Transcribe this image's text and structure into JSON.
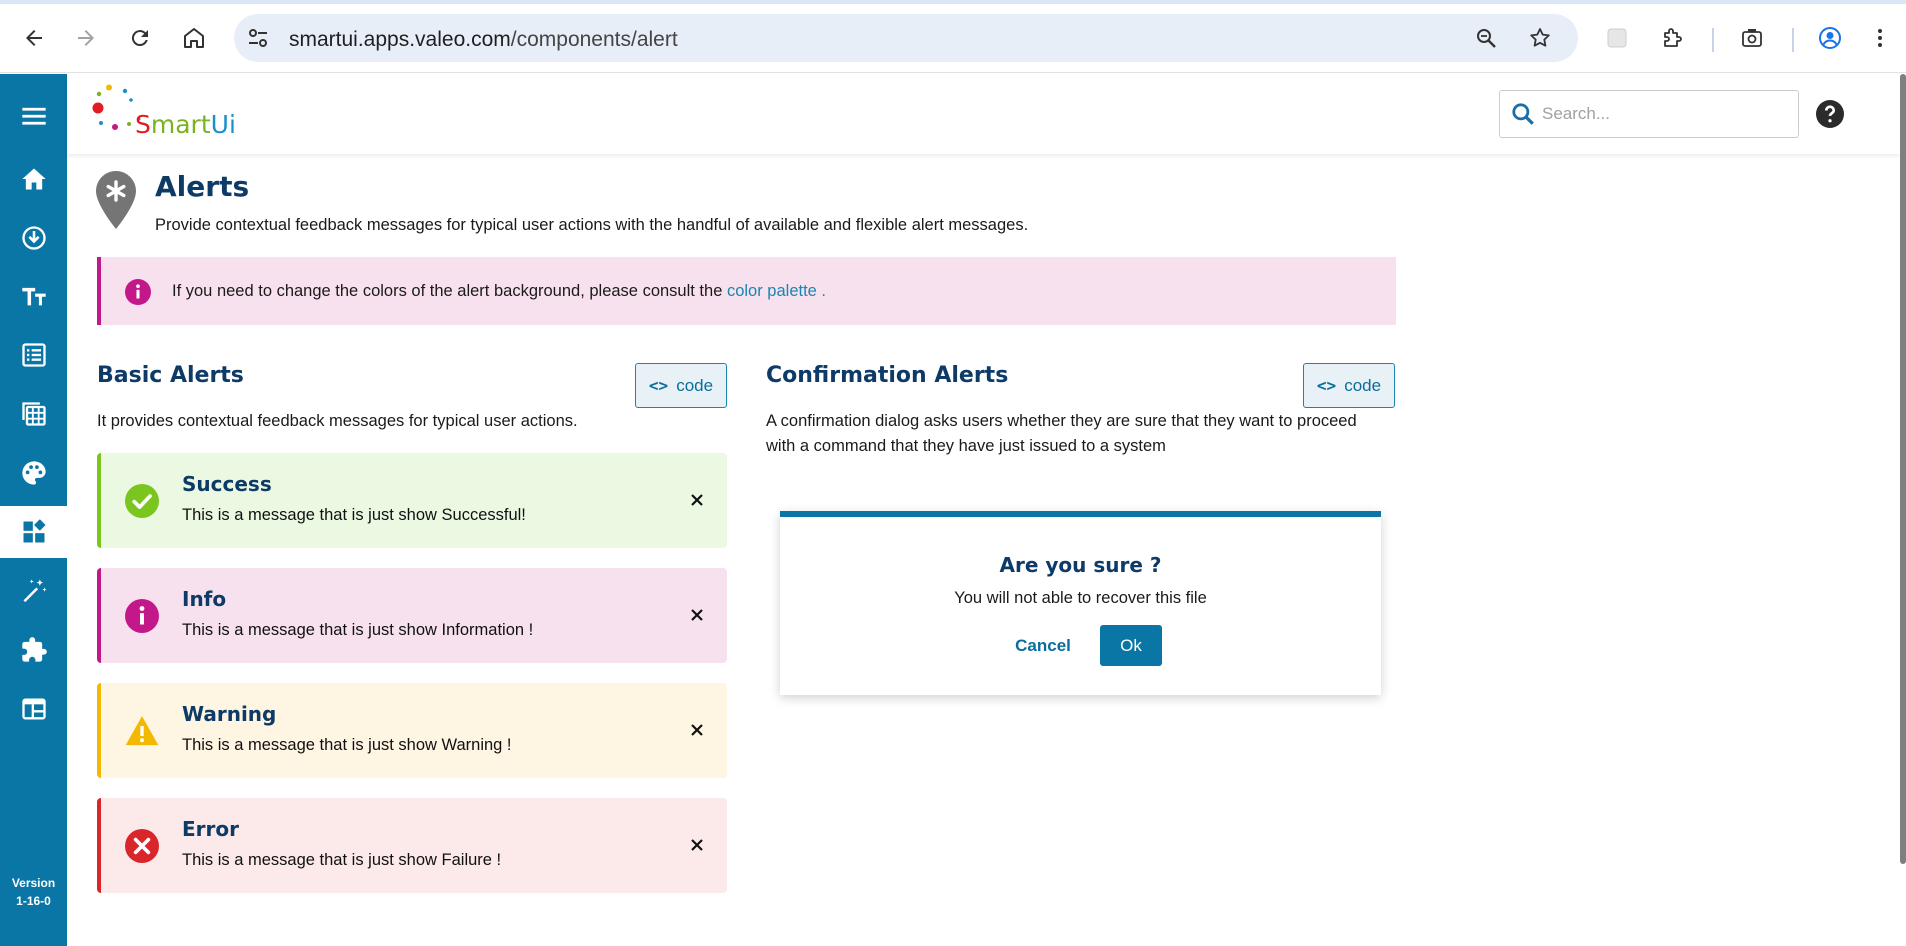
{
  "browser": {
    "url_host": "smartui.apps.valeo.com",
    "url_path": "/components/alert"
  },
  "app": {
    "logo_s": "S",
    "logo_mart": "mart",
    "logo_ui": "Ui",
    "search_placeholder": "Search...",
    "version_label": "Version",
    "version_number": "1-16-0"
  },
  "page": {
    "title": "Alerts",
    "description": "Provide contextual feedback messages for typical user actions with the handful of available and flexible alert messages."
  },
  "note": {
    "text": "If you need to change the colors of the alert background, please consult the ",
    "link": "color palette",
    "suffix": " ."
  },
  "basic": {
    "title": "Basic Alerts",
    "code_label": "code",
    "description": "It provides contextual feedback messages for typical user actions.",
    "alerts": [
      {
        "title": "Success",
        "message": "This is a message that is just show Successful!",
        "color": "#7ac61f"
      },
      {
        "title": "Info",
        "message": "This is a message that is just show Information !",
        "color": "#c2188a"
      },
      {
        "title": "Warning",
        "message": "This is a message that is just show Warning !",
        "color": "#f3b800"
      },
      {
        "title": "Error",
        "message": "This is a message that is just show Failure !",
        "color": "#d8262a"
      }
    ]
  },
  "confirmation": {
    "title": "Confirmation Alerts",
    "code_label": "code",
    "description_line1": "A confirmation dialog asks users whether they are sure that they want to proceed",
    "description_line2": "with a command that they have just issued to a system",
    "dialog": {
      "title": "Are you sure ?",
      "message": "You will not able to recover this file",
      "cancel": "Cancel",
      "ok": "Ok"
    }
  },
  "colors": {
    "sidebar": "#0a76a6",
    "heading": "#0d3a66",
    "link": "#1786b3"
  }
}
